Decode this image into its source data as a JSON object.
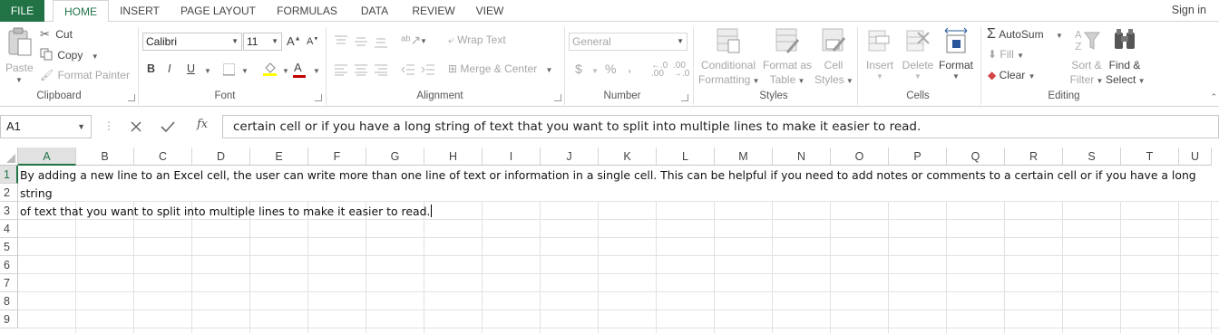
{
  "tabs": [
    "FILE",
    "HOME",
    "INSERT",
    "PAGE LAYOUT",
    "FORMULAS",
    "DATA",
    "REVIEW",
    "VIEW"
  ],
  "sign_in": "Sign in",
  "clipboard": {
    "paste": "Paste",
    "cut": "Cut",
    "copy": "Copy",
    "format_painter": "Format Painter",
    "label": "Clipboard"
  },
  "font": {
    "name": "Calibri",
    "size": "11",
    "bold": "B",
    "italic": "I",
    "underline": "U",
    "label": "Font"
  },
  "alignment": {
    "wrap_text": "Wrap Text",
    "merge_center": "Merge & Center",
    "label": "Alignment"
  },
  "number": {
    "format": "General",
    "currency": "$",
    "percent": "%",
    "comma": ",",
    "label": "Number"
  },
  "styles": {
    "conditional_1": "Conditional",
    "conditional_2": "Formatting",
    "format_as_1": "Format as",
    "format_as_2": "Table",
    "cell_styles_1": "Cell",
    "cell_styles_2": "Styles",
    "label": "Styles"
  },
  "cells": {
    "insert": "Insert",
    "delete": "Delete",
    "format": "Format",
    "label": "Cells"
  },
  "editing": {
    "autosum": "AutoSum",
    "fill": "Fill",
    "clear": "Clear",
    "sort_1": "Sort &",
    "sort_2": "Filter",
    "find_1": "Find &",
    "find_2": "Select",
    "label": "Editing"
  },
  "name_box": "A1",
  "formula_text": "certain cell or if you have a long string of text that you want to split into multiple lines to make it easier to read.",
  "columns": [
    "A",
    "B",
    "C",
    "D",
    "E",
    "F",
    "G",
    "H",
    "I",
    "J",
    "K",
    "L",
    "M",
    "N",
    "O",
    "P",
    "Q",
    "R",
    "S",
    "T",
    "U"
  ],
  "rows": [
    "1",
    "2",
    "3",
    "4",
    "5",
    "6",
    "7",
    "8",
    "9"
  ],
  "cell_a1": {
    "line1": "By adding a new line to an Excel cell, the user can write more than one line of text or information in a single cell. This can be helpful if you need to add notes or comments to a certain cell or if you have a long string",
    "line2": "of text that you want to split into multiple lines to make it easier to read."
  },
  "colors": {
    "accent": "#217346",
    "header_sel": "#e1e1e1",
    "font_red": "#c00000"
  }
}
